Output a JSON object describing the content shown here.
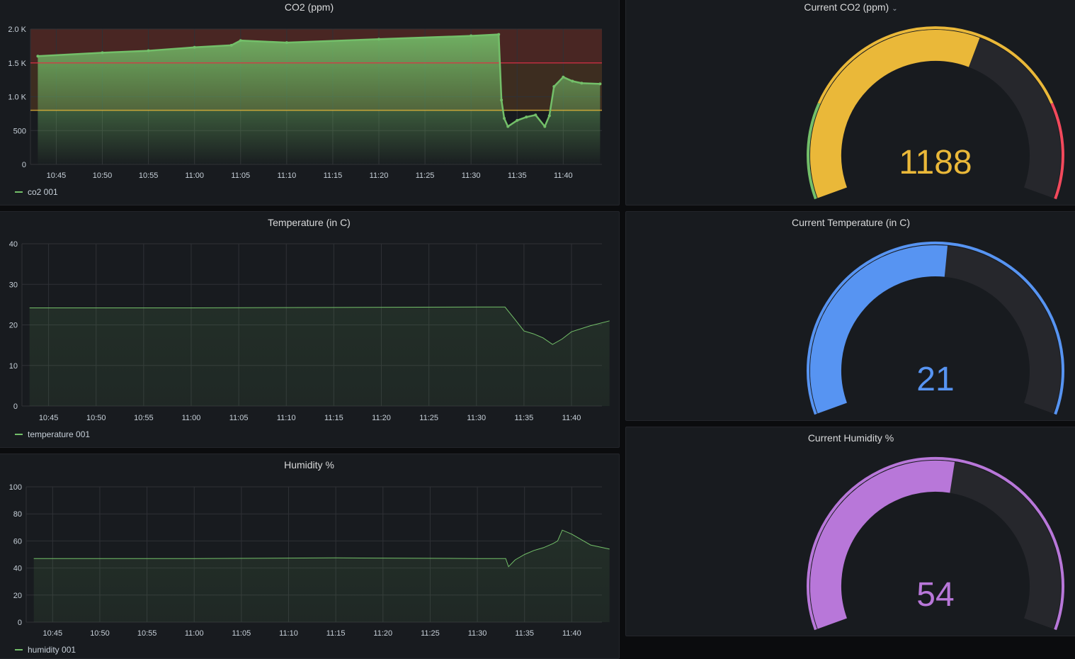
{
  "panels": {
    "co2_graph": {
      "title": "CO2 (ppm)",
      "legend": "co2 001",
      "y_ticks": [
        "0",
        "500",
        "1.0 K",
        "1.5 K",
        "2.0 K"
      ]
    },
    "temp_graph": {
      "title": "Temperature (in C)",
      "legend": "temperature 001",
      "y_ticks": [
        "0",
        "10",
        "20",
        "30",
        "40"
      ]
    },
    "hum_graph": {
      "title": "Humidity %",
      "legend": "humidity 001",
      "y_ticks": [
        "0",
        "20",
        "40",
        "60",
        "80",
        "100"
      ]
    },
    "co2_gauge": {
      "title": "Current CO2 (ppm)",
      "value": "1188"
    },
    "temp_gauge": {
      "title": "Current Temperature (in C)",
      "value": "21"
    },
    "hum_gauge": {
      "title": "Current Humidity %",
      "value": "54"
    }
  },
  "x_ticks": [
    "10:45",
    "10:50",
    "10:55",
    "11:00",
    "11:05",
    "11:10",
    "11:15",
    "11:20",
    "11:25",
    "11:30",
    "11:35",
    "11:40"
  ],
  "colors": {
    "series": "#73bf69",
    "threshold_yellow": "#eab839",
    "threshold_red": "#e02f44",
    "gauge_green": "#73bf69",
    "gauge_yellow": "#eab839",
    "gauge_red": "#f2495c",
    "gauge_blue": "#5794f2",
    "gauge_purple": "#b877d9",
    "gauge_track": "#26272c"
  },
  "chart_data": [
    {
      "type": "line",
      "title": "CO2 (ppm)",
      "series": [
        {
          "name": "co2 001",
          "x": [
            "10:43",
            "10:50",
            "10:55",
            "11:00",
            "11:04",
            "11:05",
            "11:10",
            "11:20",
            "11:30",
            "11:33",
            "11:33.3",
            "11:33.6",
            "11:34",
            "11:35",
            "11:36",
            "11:37",
            "11:38",
            "11:38.5",
            "11:39",
            "11:40",
            "11:41",
            "11:42",
            "11:44"
          ],
          "values": [
            1600,
            1650,
            1680,
            1730,
            1760,
            1830,
            1800,
            1850,
            1900,
            1920,
            950,
            680,
            560,
            650,
            700,
            730,
            560,
            720,
            1150,
            1290,
            1230,
            1200,
            1190
          ]
        }
      ],
      "thresholds": [
        800,
        1500
      ],
      "ylim": [
        0,
        2000
      ]
    },
    {
      "type": "line",
      "title": "Temperature (in C)",
      "series": [
        {
          "name": "temperature 001",
          "x": [
            "10:43",
            "11:00",
            "11:15",
            "11:30",
            "11:33",
            "11:34",
            "11:35",
            "11:36",
            "11:37",
            "11:38",
            "11:39",
            "11:40",
            "11:42",
            "11:44"
          ],
          "values": [
            24.2,
            24.2,
            24.3,
            24.4,
            24.4,
            21.5,
            18.5,
            17.8,
            16.8,
            15.2,
            16.5,
            18.3,
            19.8,
            21
          ]
        }
      ],
      "ylim": [
        0,
        40
      ]
    },
    {
      "type": "line",
      "title": "Humidity %",
      "series": [
        {
          "name": "humidity 001",
          "x": [
            "10:43",
            "11:00",
            "11:15",
            "11:30",
            "11:33",
            "11:33.3",
            "11:34",
            "11:35",
            "11:36",
            "11:37",
            "11:38",
            "11:38.5",
            "11:39",
            "11:40",
            "11:42",
            "11:44"
          ],
          "values": [
            47,
            47,
            47.5,
            47,
            47,
            41,
            46,
            50,
            53,
            55,
            58,
            60,
            68,
            65,
            57,
            54
          ]
        }
      ],
      "ylim": [
        0,
        100
      ]
    }
  ],
  "gauges": {
    "co2": {
      "value": 1188,
      "min": 0,
      "max": 2000,
      "thresholds": [
        {
          "to": 400,
          "color": "green"
        },
        {
          "to": 1600,
          "color": "yellow"
        },
        {
          "to": 2000,
          "color": "red"
        }
      ]
    },
    "temp": {
      "value": 21,
      "min": 0,
      "max": 40
    },
    "hum": {
      "value": 54,
      "min": 0,
      "max": 100
    }
  }
}
